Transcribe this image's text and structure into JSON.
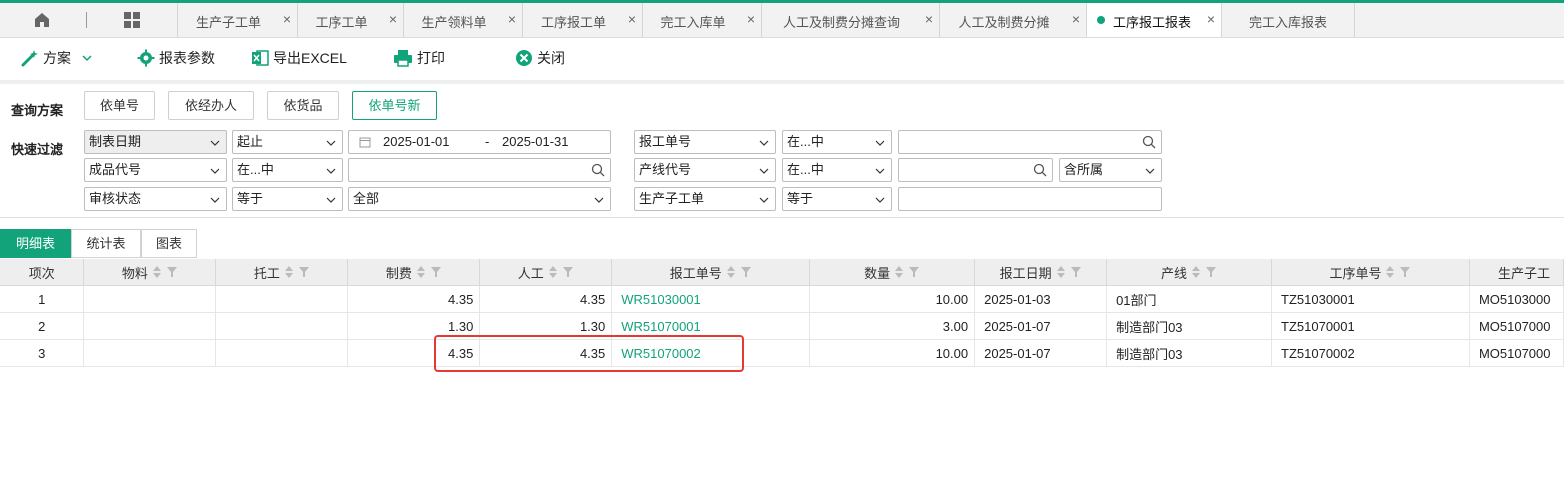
{
  "tabs": [
    {
      "label": "生产子工单",
      "active": false
    },
    {
      "label": "工序工单",
      "active": false
    },
    {
      "label": "生产领料单",
      "active": false
    },
    {
      "label": "工序报工单",
      "active": false
    },
    {
      "label": "完工入库单",
      "active": false
    },
    {
      "label": "人工及制费分摊查询",
      "active": false
    },
    {
      "label": "人工及制费分摊",
      "active": false
    },
    {
      "label": "工序报工报表",
      "active": true
    },
    {
      "label": "完工入库报表",
      "active": false
    }
  ],
  "toolbar": {
    "scheme": "方案",
    "params": "报表参数",
    "export": "导出EXCEL",
    "print": "打印",
    "close": "关闭"
  },
  "query": {
    "label": "查询方案",
    "buttons": [
      "依单号",
      "依经办人",
      "依货品",
      "依单号新"
    ],
    "active_index": 3
  },
  "filter": {
    "label": "快速过滤",
    "row1": {
      "field": "制表日期",
      "op": "起止",
      "date_from": "2025-01-01",
      "date_sep": "-",
      "date_to": "2025-01-31",
      "field2": "报工单号",
      "op2": "在...中",
      "value2": ""
    },
    "row2": {
      "field": "成品代号",
      "op": "在...中",
      "value": "",
      "field2": "产线代号",
      "op2": "在...中",
      "value2": "",
      "scope": "含所属"
    },
    "row3": {
      "field": "审核状态",
      "op": "等于",
      "value": "全部",
      "field2": "生产子工单",
      "op2": "等于",
      "value2": ""
    }
  },
  "view_tabs": [
    "明细表",
    "统计表",
    "图表"
  ],
  "table": {
    "columns": [
      "项次",
      "物料",
      "托工",
      "制费",
      "人工",
      "报工单号",
      "数量",
      "报工日期",
      "产线",
      "工序单号",
      "生产子工"
    ],
    "rows": [
      {
        "seq": "1",
        "material": "",
        "outsource": "",
        "overhead": "4.35",
        "labor": "4.35",
        "report_no": "WR51030001",
        "qty": "10.00",
        "date": "2025-01-03",
        "line": "01部门",
        "op_no": "TZ51030001",
        "sub_order": "MO5103000"
      },
      {
        "seq": "2",
        "material": "",
        "outsource": "",
        "overhead": "1.30",
        "labor": "1.30",
        "report_no": "WR51070001",
        "qty": "3.00",
        "date": "2025-01-07",
        "line": "制造部门03",
        "op_no": "TZ51070001",
        "sub_order": "MO5107000"
      },
      {
        "seq": "3",
        "material": "",
        "outsource": "",
        "overhead": "4.35",
        "labor": "4.35",
        "report_no": "WR51070002",
        "qty": "10.00",
        "date": "2025-01-07",
        "line": "制造部门03",
        "op_no": "TZ51070002",
        "sub_order": "MO5107000"
      }
    ]
  },
  "colors": {
    "accent": "#12a37a",
    "highlight": "#e53935"
  }
}
